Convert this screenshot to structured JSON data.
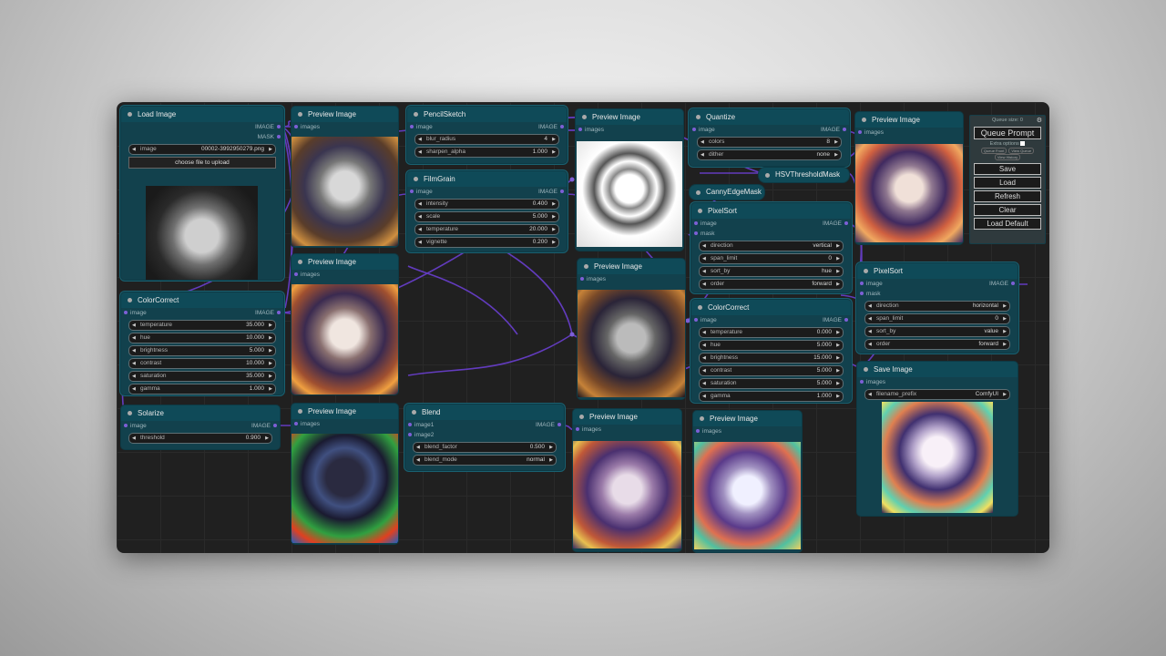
{
  "colors": {
    "accent": "#7d5fd6",
    "node_header": "#0f4a58",
    "node_body": "#12414d",
    "canvas": "#202020"
  },
  "nodes": {
    "load_image": {
      "title": "Load Image",
      "out1": "IMAGE",
      "out2": "MASK",
      "image_label": "image",
      "image_value": "00002-3992950279.png",
      "upload": "choose file to upload"
    },
    "preview1": {
      "title": "Preview Image",
      "in": "images"
    },
    "preview2": {
      "title": "Preview Image",
      "in": "images"
    },
    "colorcorrect1": {
      "title": "ColorCorrect",
      "in": "image",
      "out": "IMAGE",
      "widgets": [
        {
          "l": "temperature",
          "v": "35.000"
        },
        {
          "l": "hue",
          "v": "10.000"
        },
        {
          "l": "brightness",
          "v": "5.000"
        },
        {
          "l": "contrast",
          "v": "10.000"
        },
        {
          "l": "saturation",
          "v": "35.000"
        },
        {
          "l": "gamma",
          "v": "1.000"
        }
      ]
    },
    "solarize": {
      "title": "Solarize",
      "in": "image",
      "out": "IMAGE",
      "widgets": [
        {
          "l": "threshold",
          "v": "0.900"
        }
      ]
    },
    "preview3": {
      "title": "Preview Image",
      "in": "images"
    },
    "pencilsketch": {
      "title": "PencilSketch",
      "in": "image",
      "out": "IMAGE",
      "widgets": [
        {
          "l": "blur_radius",
          "v": "4"
        },
        {
          "l": "sharpen_alpha",
          "v": "1.000"
        }
      ]
    },
    "filmgrain": {
      "title": "FilmGrain",
      "in": "image",
      "out": "IMAGE",
      "widgets": [
        {
          "l": "intensity",
          "v": "0.400"
        },
        {
          "l": "scale",
          "v": "5.000"
        },
        {
          "l": "temperature",
          "v": "20.000"
        },
        {
          "l": "vignette",
          "v": "0.200"
        }
      ]
    },
    "blend": {
      "title": "Blend",
      "in1": "image1",
      "in2": "image2",
      "out": "IMAGE",
      "widgets": [
        {
          "l": "blend_factor",
          "v": "0.500"
        },
        {
          "l": "blend_mode",
          "v": "normal"
        }
      ]
    },
    "preview4": {
      "title": "Preview Image",
      "in": "images"
    },
    "preview5": {
      "title": "Preview Image",
      "in": "images"
    },
    "preview6": {
      "title": "Preview Image",
      "in": "images"
    },
    "quantize": {
      "title": "Quantize",
      "in": "image",
      "out": "IMAGE",
      "widgets": [
        {
          "l": "colors",
          "v": "8"
        },
        {
          "l": "dither",
          "v": "none"
        }
      ]
    },
    "hsv": {
      "title": "HSVThresholdMask"
    },
    "canny": {
      "title": "CannyEdgeMask"
    },
    "pixelsort1": {
      "title": "PixelSort",
      "in1": "image",
      "in2": "mask",
      "out": "IMAGE",
      "widgets": [
        {
          "l": "direction",
          "v": "vertical"
        },
        {
          "l": "span_limit",
          "v": "0"
        },
        {
          "l": "sort_by",
          "v": "hue"
        },
        {
          "l": "order",
          "v": "forward"
        }
      ]
    },
    "colorcorrect2": {
      "title": "ColorCorrect",
      "in": "image",
      "out": "IMAGE",
      "widgets": [
        {
          "l": "temperature",
          "v": "0.000"
        },
        {
          "l": "hue",
          "v": "5.000"
        },
        {
          "l": "brightness",
          "v": "15.000"
        },
        {
          "l": "contrast",
          "v": "5.000"
        },
        {
          "l": "saturation",
          "v": "5.000"
        },
        {
          "l": "gamma",
          "v": "1.000"
        }
      ]
    },
    "preview7": {
      "title": "Preview Image",
      "in": "images"
    },
    "preview8": {
      "title": "Preview Image",
      "in": "images"
    },
    "pixelsort2": {
      "title": "PixelSort",
      "in1": "image",
      "in2": "mask",
      "out": "IMAGE",
      "widgets": [
        {
          "l": "direction",
          "v": "horizontal"
        },
        {
          "l": "span_limit",
          "v": "0"
        },
        {
          "l": "sort_by",
          "v": "value"
        },
        {
          "l": "order",
          "v": "forward"
        }
      ]
    },
    "saveimage": {
      "title": "Save Image",
      "in": "images",
      "widgets": [
        {
          "l": "filename_prefix",
          "v": "ComfyUI"
        }
      ]
    }
  },
  "panel": {
    "queue_size": "Queue size: 0",
    "queue_prompt": "Queue Prompt",
    "extra_options": "Extra options",
    "queue_front": "Queue Front",
    "view_queue": "View Queue",
    "view_history": "View History",
    "save": "Save",
    "load": "Load",
    "refresh": "Refresh",
    "clear": "Clear",
    "load_default": "Load Default"
  }
}
